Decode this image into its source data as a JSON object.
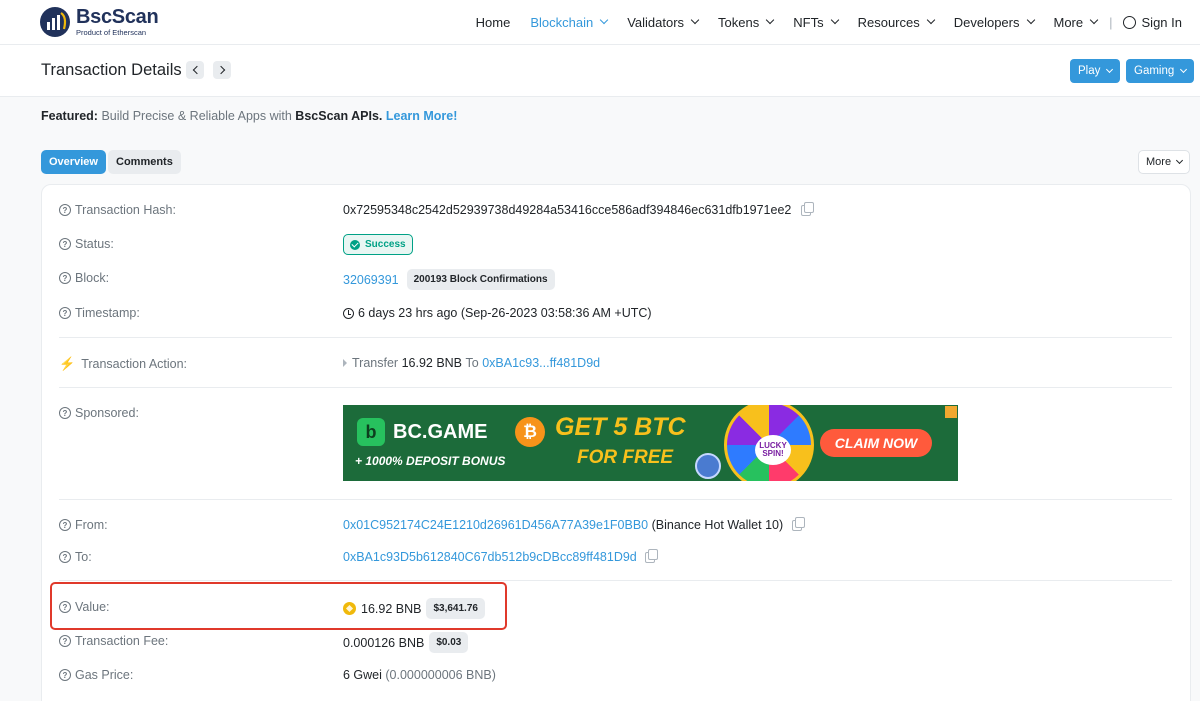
{
  "header": {
    "logo_title": "BscScan",
    "logo_sub": "Product of Etherscan",
    "nav": [
      {
        "label": "Home",
        "has_dropdown": false,
        "active": false
      },
      {
        "label": "Blockchain",
        "has_dropdown": true,
        "active": true
      },
      {
        "label": "Validators",
        "has_dropdown": true,
        "active": false
      },
      {
        "label": "Tokens",
        "has_dropdown": true,
        "active": false
      },
      {
        "label": "NFTs",
        "has_dropdown": true,
        "active": false
      },
      {
        "label": "Resources",
        "has_dropdown": true,
        "active": false
      },
      {
        "label": "Developers",
        "has_dropdown": true,
        "active": false
      },
      {
        "label": "More",
        "has_dropdown": true,
        "active": false
      }
    ],
    "separator": "|",
    "signin": "Sign In"
  },
  "titlebar": {
    "title": "Transaction Details",
    "play": "Play",
    "gaming": "Gaming"
  },
  "featured": {
    "prefix": "Featured:",
    "text": "Build Precise & Reliable Apps with",
    "brand": "BscScan APIs.",
    "link": "Learn More!"
  },
  "tabs": {
    "overview": "Overview",
    "comments": "Comments",
    "more": "More"
  },
  "details": {
    "hash_label": "Transaction Hash:",
    "hash": "0x72595348c2542d52939738d49284a53416cce586adf394846ec631dfb1971ee2",
    "status_label": "Status:",
    "status": "Success",
    "block_label": "Block:",
    "block": "32069391",
    "confirmations": "200193 Block Confirmations",
    "timestamp_label": "Timestamp:",
    "timestamp": "6 days 23 hrs ago (Sep-26-2023 03:58:36 AM +UTC)",
    "action_label": "Transaction Action:",
    "action_verb": "Transfer",
    "action_amount": "16.92 BNB",
    "action_to": "To",
    "action_address": "0xBA1c93...ff481D9d",
    "sponsored_label": "Sponsored:",
    "from_label": "From:",
    "from_address": "0x01C952174C24E1210d26961D456A77A39e1F0BB0",
    "from_name": "(Binance Hot Wallet 10)",
    "to_label": "To:",
    "to_address": "0xBA1c93D5b612840C67db512b9cDBcc89ff481D9d",
    "value_label": "Value:",
    "value": "16.92 BNB",
    "value_usd": "$3,641.76",
    "fee_label": "Transaction Fee:",
    "fee": "0.000126 BNB",
    "fee_usd": "$0.03",
    "gas_label": "Gas Price:",
    "gas": "6 Gwei",
    "gas_bnb": "(0.000000006 BNB)"
  },
  "ad": {
    "logo_letter": "b",
    "name": "BC.GAME",
    "bonus": "+ 1000% DEPOSIT BONUS",
    "coin": "₿",
    "get": "GET 5 BTC",
    "free": "FOR FREE",
    "lucky": "LUCKY SPIN!",
    "claim": "CLAIM NOW"
  },
  "colors": {
    "accent": "#3498db",
    "success": "#00a186",
    "highlight": "#e0392b"
  }
}
